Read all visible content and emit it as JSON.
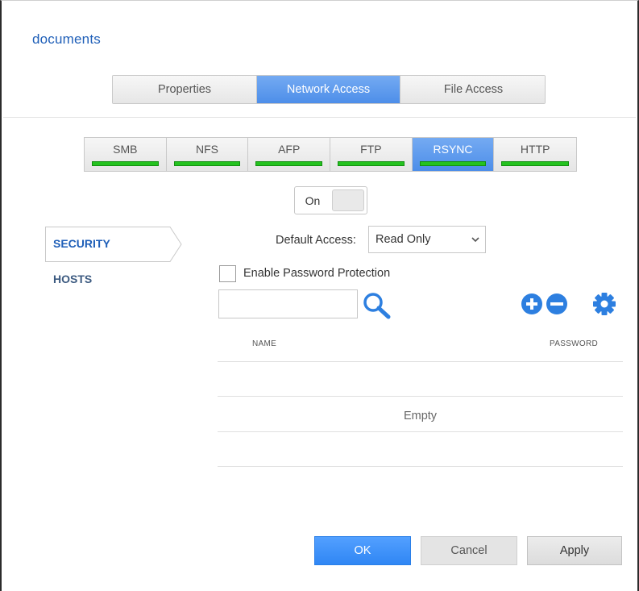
{
  "header": {
    "title": "documents"
  },
  "main_tabs": [
    {
      "label": "Properties",
      "active": false
    },
    {
      "label": "Network Access",
      "active": true
    },
    {
      "label": "File Access",
      "active": false
    }
  ],
  "protocol_tabs": [
    {
      "label": "SMB",
      "status_color": "#24c21f"
    },
    {
      "label": "NFS",
      "status_color": "#24c21f"
    },
    {
      "label": "AFP",
      "status_color": "#24c21f"
    },
    {
      "label": "FTP",
      "status_color": "#24c21f"
    },
    {
      "label": "RSYNC",
      "status_color": "#24c21f",
      "active": true
    },
    {
      "label": "HTTP",
      "status_color": "#24c21f"
    }
  ],
  "toggle": {
    "label": "On"
  },
  "sidebar": {
    "items": [
      {
        "label": "SECURITY",
        "active": true
      },
      {
        "label": "HOSTS",
        "active": false
      }
    ]
  },
  "form": {
    "default_access_label": "Default Access:",
    "default_access_value": "Read Only",
    "password_protection_label": "Enable Password Protection",
    "password_protection_checked": false,
    "search_value": ""
  },
  "toolbar": {
    "icons": [
      "plus-circle-icon",
      "minus-circle-icon",
      "gear-icon"
    ]
  },
  "table": {
    "columns": [
      "NAME",
      "PASSWORD"
    ],
    "empty_text": "Empty"
  },
  "footer": {
    "ok_label": "OK",
    "cancel_label": "Cancel",
    "apply_label": "Apply"
  },
  "colors": {
    "accent": "#4d8ee9",
    "title": "#1f5fb8",
    "status_ok": "#24c21f"
  }
}
